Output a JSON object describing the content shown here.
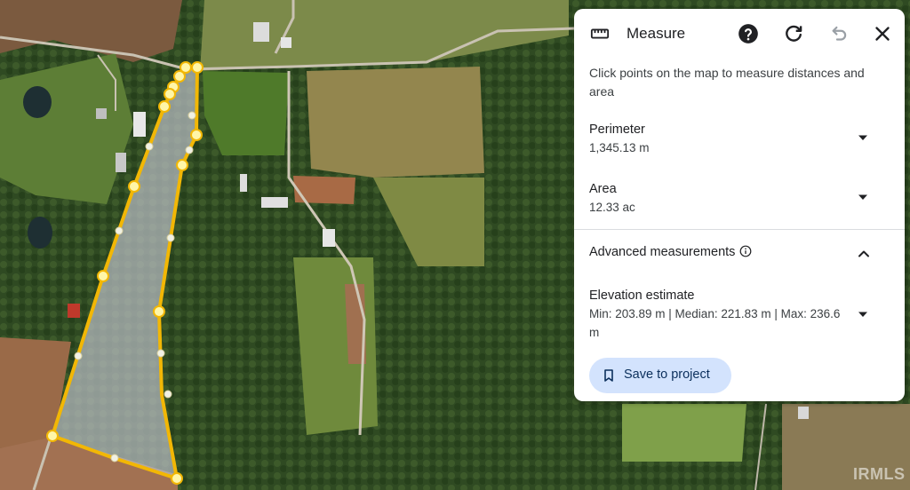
{
  "panel": {
    "title": "Measure",
    "title_icon": "ruler-icon",
    "header_icons": [
      "help-icon",
      "refresh-icon",
      "undo-icon",
      "close-icon"
    ],
    "instructions": "Click points on the map to measure distances and area",
    "perimeter": {
      "label": "Perimeter",
      "value": "1,345.13 m"
    },
    "area": {
      "label": "Area",
      "value": "12.33 ac"
    },
    "advanced": {
      "label": "Advanced measurements"
    },
    "elevation": {
      "label": "Elevation estimate",
      "value": "Min: 203.89 m | Median: 221.83 m | Max: 236.6 m"
    },
    "save_label": "Save to project"
  },
  "map": {
    "watermark": "IRMLS",
    "polygon_color": "#f2b705",
    "polygon_fill": "#b8bcc4",
    "vertex_fill": "#fff6a8"
  }
}
